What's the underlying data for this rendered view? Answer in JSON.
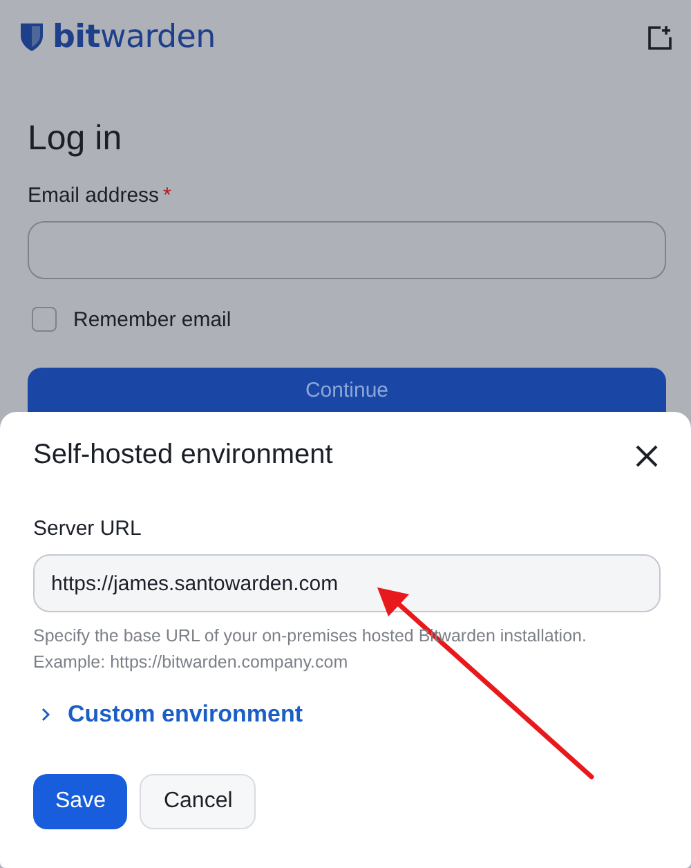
{
  "header": {
    "logo": "**bit**warden"
  },
  "login": {
    "title": "Log in",
    "email_label": "Email address",
    "required_mark": "*",
    "remember": {
      "label": "Remember email",
      "checked": false
    },
    "continue_button": "Continue"
  },
  "dialog": {
    "title": "Self-hosted environment",
    "server_url": {
      "label": "Server URL",
      "value": "https://james.santowarden.com",
      "hint": "Specify the base URL of your on-premises hosted Bitwarden installation. Example: https://bitwarden.company.com"
    },
    "custom_environment": {
      "label": "Custom environment",
      "expanded": false
    },
    "buttons": [
      {
        "label": "Save",
        "kind": "primary"
      },
      {
        "label": "Cancel",
        "kind": "secondary"
      }
    ]
  }
}
